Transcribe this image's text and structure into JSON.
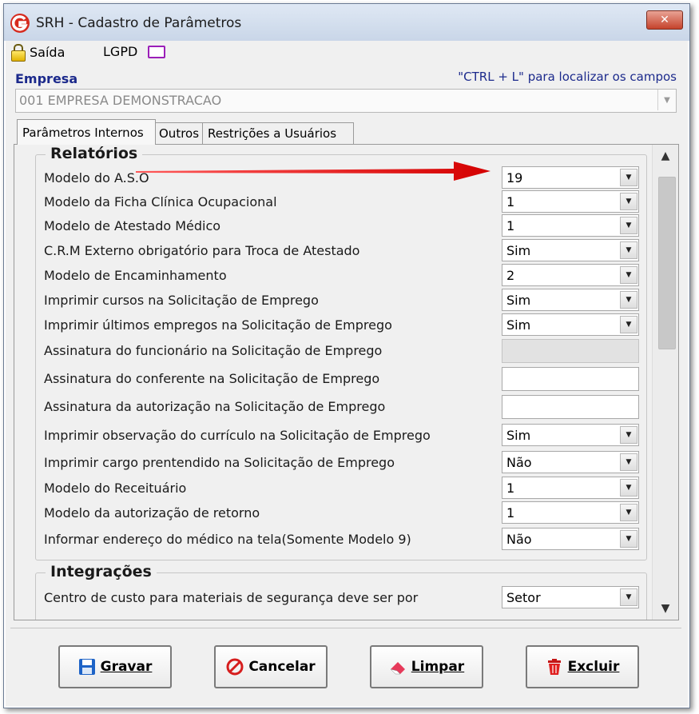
{
  "window": {
    "title": "SRH - Cadastro de Parâmetros",
    "close_label": "✕"
  },
  "menu": {
    "saida": "Saída",
    "lgpd": "LGPD"
  },
  "empresa": {
    "label": "Empresa",
    "hint": "\"CTRL + L\" para localizar os campos",
    "value": "001 EMPRESA DEMONSTRACAO"
  },
  "tabs": [
    {
      "label": "Parâmetros Internos",
      "active": true
    },
    {
      "label": "Outros",
      "active": false
    },
    {
      "label": "Restrições a Usuários",
      "active": false
    }
  ],
  "relatorios": {
    "title": "Relatórios",
    "rows": [
      {
        "label": "Modelo do A.S.O",
        "type": "combo",
        "value": "19"
      },
      {
        "label": "Modelo da Ficha Clínica Ocupacional",
        "type": "combo",
        "value": "1"
      },
      {
        "label": "Modelo de Atestado Médico",
        "type": "combo",
        "value": "1"
      },
      {
        "label": "C.R.M Externo obrigatório para Troca de Atestado",
        "type": "combo",
        "value": "Sim"
      },
      {
        "label": "Modelo de Encaminhamento",
        "type": "combo",
        "value": "2"
      },
      {
        "label": "Imprimir cursos na Solicitação de Emprego",
        "type": "combo",
        "value": "Sim"
      },
      {
        "label": "Imprimir últimos empregos na Solicitação de Emprego",
        "type": "combo",
        "value": "Sim"
      },
      {
        "label": "Assinatura do funcionário na Solicitação de Emprego",
        "type": "text-disabled",
        "value": ""
      },
      {
        "label": "Assinatura do conferente na Solicitação de Emprego",
        "type": "text",
        "value": ""
      },
      {
        "label": "Assinatura da autorização na Solicitação de Emprego",
        "type": "text",
        "value": ""
      },
      {
        "label": "Imprimir observação do currículo na Solicitação de Emprego",
        "type": "combo",
        "value": "Sim"
      },
      {
        "label": "Imprimir cargo prentendido na Solicitação de Emprego",
        "type": "combo",
        "value": "Não"
      },
      {
        "label": "Modelo do Receituário",
        "type": "combo",
        "value": "1"
      },
      {
        "label": "Modelo da autorização de retorno",
        "type": "combo",
        "value": "1"
      },
      {
        "label": "Informar endereço do médico na tela(Somente Modelo 9)",
        "type": "combo",
        "value": "Não"
      }
    ]
  },
  "integracoes": {
    "title": "Integrações",
    "rows": [
      {
        "label": "Centro de custo para materiais de segurança deve ser por",
        "type": "combo",
        "value": "Setor"
      }
    ]
  },
  "buttons": {
    "gravar": "Gravar",
    "cancelar": "Cancelar",
    "limpar": "Limpar",
    "excluir": "Excluir"
  },
  "colors": {
    "accent": "#1c2a8c",
    "arrow": "#e00000",
    "lgpd_icon": "#9b1fb8"
  }
}
